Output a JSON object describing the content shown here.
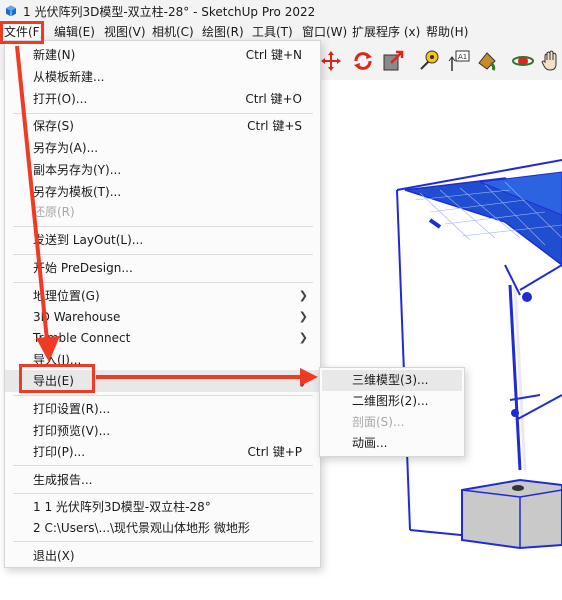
{
  "window": {
    "title": "1 光伏阵列3D模型-双立柱-28° - SketchUp Pro 2022"
  },
  "menubar": {
    "items": [
      "文件(F)",
      "编辑(E)",
      "视图(V)",
      "相机(C)",
      "绘图(R)",
      "工具(T)",
      "窗口(W)",
      "扩展程序 (x)",
      "帮助(H)"
    ]
  },
  "file_menu": {
    "items": [
      {
        "label": "新建(N)",
        "shortcut": "Ctrl 键+N"
      },
      {
        "label": "从模板新建..."
      },
      {
        "label": "打开(O)...",
        "shortcut": "Ctrl 键+O"
      },
      {
        "label": "保存(S)",
        "shortcut": "Ctrl 键+S"
      },
      {
        "label": "另存为(A)..."
      },
      {
        "label": "副本另存为(Y)..."
      },
      {
        "label": "另存为模板(T)..."
      },
      {
        "label": "还原(R)"
      },
      {
        "label": "发送到 LayOut(L)..."
      },
      {
        "label": "开始 PreDesign..."
      },
      {
        "label": "地理位置(G)"
      },
      {
        "label": "3D Warehouse"
      },
      {
        "label": "Trimble Connect"
      },
      {
        "label": "导入(I)..."
      },
      {
        "label": "导出(E)"
      },
      {
        "label": "打印设置(R)..."
      },
      {
        "label": "打印预览(V)..."
      },
      {
        "label": "打印(P)...",
        "shortcut": "Ctrl 键+P"
      },
      {
        "label": "生成报告..."
      },
      {
        "label": "1 1 光伏阵列3D模型-双立柱-28°"
      },
      {
        "label": "2 C:\\Users\\...\\现代景观山体地形 微地形"
      },
      {
        "label": "退出(X)"
      }
    ]
  },
  "export_submenu": {
    "items": [
      "三维模型(3)...",
      "二维图形(2)...",
      "剖面(S)...",
      "动画..."
    ]
  },
  "colors": {
    "annotation": "#ef3b24",
    "model_outline": "#1f2bd6",
    "panel_blue": "#1f4fd0",
    "concrete": "#c9c9c9"
  }
}
